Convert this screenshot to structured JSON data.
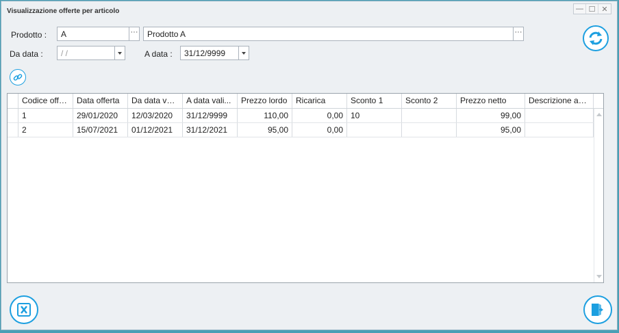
{
  "window": {
    "title": "Visualizzazione offerte per articolo",
    "controls": {
      "minimize": "—",
      "maximize": "☐",
      "close": "✕"
    }
  },
  "filters": {
    "product_label": "Prodotto :",
    "product_code": "A",
    "product_name": "Prodotto A",
    "dots": "···",
    "from_label": "Da data :",
    "from_value": " /  /",
    "to_label": "A data :",
    "to_value": "31/12/9999"
  },
  "icons": {
    "refresh": "refresh-icon",
    "link": "link-icon",
    "excel": "excel-icon",
    "exit": "exit-icon"
  },
  "colors": {
    "accent": "#1c9fe0",
    "frame": "#4a9fb5"
  },
  "table": {
    "columns": [
      "Codice offe...",
      "Data offerta",
      "Da data vali...",
      "A data vali...",
      "Prezzo lordo",
      "Ricarica",
      "Sconto 1",
      "Sconto 2",
      "Prezzo netto",
      "Descrizione ag..."
    ],
    "rows": [
      [
        "1",
        "29/01/2020",
        "12/03/2020",
        "31/12/9999",
        "110,00",
        "0,00",
        "10",
        "",
        "99,00",
        ""
      ],
      [
        "2",
        "15/07/2021",
        "01/12/2021",
        "31/12/2021",
        "95,00",
        "0,00",
        "",
        "",
        "95,00",
        ""
      ]
    ]
  }
}
